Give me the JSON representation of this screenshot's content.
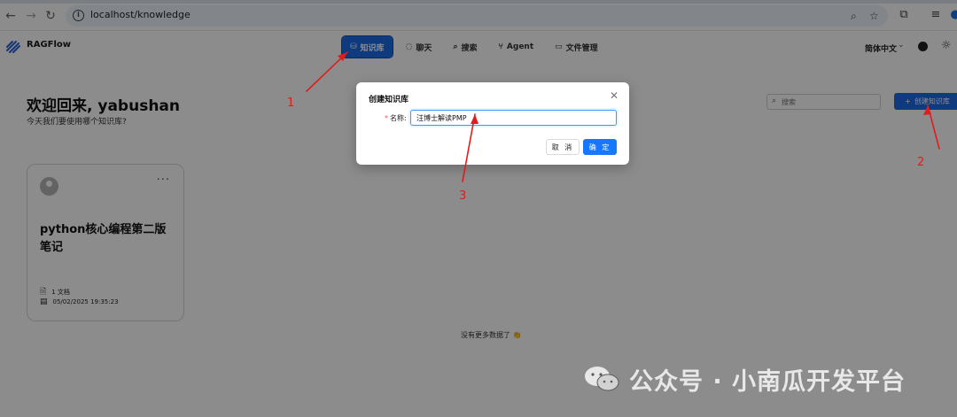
{
  "browser": {
    "url": "localhost/knowledge"
  },
  "app": {
    "name": "RAGFlow",
    "nav": [
      {
        "label": "知识库",
        "icon": "database-icon",
        "active": true
      },
      {
        "label": "聊天",
        "icon": "chat-icon",
        "active": false
      },
      {
        "label": "搜索",
        "icon": "search-icon",
        "active": false
      },
      {
        "label": "Agent",
        "icon": "agent-icon",
        "active": false
      },
      {
        "label": "文件管理",
        "icon": "folder-icon",
        "active": false
      }
    ],
    "language": "简体中文"
  },
  "main": {
    "welcome_title": "欢迎回来, yabushan",
    "welcome_subtitle": "今天我们要使用哪个知识库?",
    "search_placeholder": "搜索",
    "create_button": "创建知识库",
    "no_more": "没有更多数据了 👏"
  },
  "cards": [
    {
      "title": "python核心编程第二版笔记",
      "doc_count": "1 文档",
      "date": "05/02/2025 19:35:23"
    }
  ],
  "modal": {
    "title": "创建知识库",
    "required_mark": "*",
    "name_label": "名称:",
    "name_value": "汪博士解读PMP",
    "cancel": "取 消",
    "ok": "确 定"
  },
  "annotations": {
    "labels": [
      "1",
      "2",
      "3"
    ],
    "color": "#e21b1b"
  },
  "watermark": "公众号 · 小南瓜开发平台",
  "colors": {
    "primary": "#1d6be3",
    "modal_primary": "#1677ff"
  }
}
